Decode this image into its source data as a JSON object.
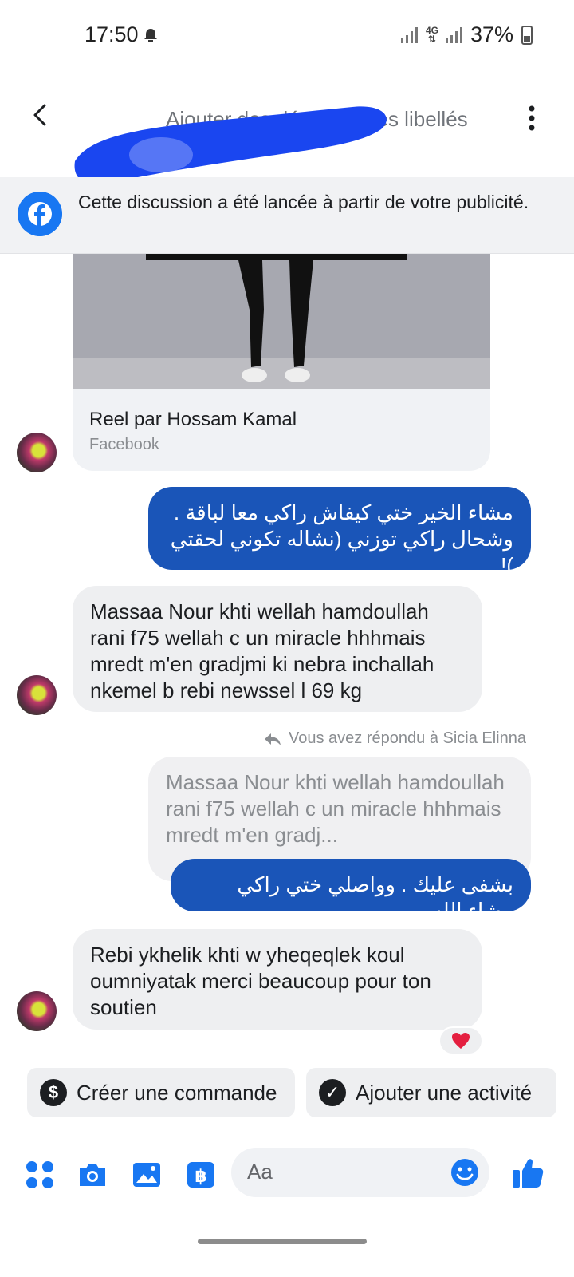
{
  "status_bar": {
    "time": "17:50",
    "network": "4G",
    "battery": "37%"
  },
  "header": {
    "subtitle": "Ajouter des détails et des libellés"
  },
  "notice": {
    "text": "Cette discussion a été lancée à partir de votre publicité."
  },
  "reel": {
    "title": "Reel par Hossam Kamal",
    "source": "Facebook"
  },
  "messages": [
    {
      "dir": "out",
      "text": "مشاء الخير ختي   كيفاش راكي معا لباقة . وشحال راكي توزني (نشاله تكوني لحقتي )!"
    },
    {
      "dir": "in",
      "text": "Massaa Nour khti wellah hamdoullah rani f75 wellah c un miracle hhhmais mredt m'en gradjmi ki nebra inchallah nkemel b rebi newssel l 69 kg"
    },
    {
      "dir": "reply_label",
      "text": "Vous avez répondu à Sicia Elinna"
    },
    {
      "dir": "quote",
      "text": "Massaa Nour khti wellah hamdoullah rani f75 wellah c un miracle hhhmais mredt m'en gradj..."
    },
    {
      "dir": "out",
      "text": "بشفى عليك . وواصلي ختي راكي مشاء الله"
    },
    {
      "dir": "in",
      "text": "Rebi ykhelik khti w yheqeqlek koul oumniyatak merci beaucoup pour ton soutien",
      "reaction": "heart"
    }
  ],
  "quick_actions": {
    "create_order": "Créer une commande",
    "add_activity": "Ajouter une activité"
  },
  "composer": {
    "placeholder": "Aa"
  },
  "colors": {
    "accent": "#1877f2",
    "outgoing_bubble": "#1a55b8",
    "incoming_bubble": "#eeeff1",
    "redaction": "#1a46f0"
  }
}
